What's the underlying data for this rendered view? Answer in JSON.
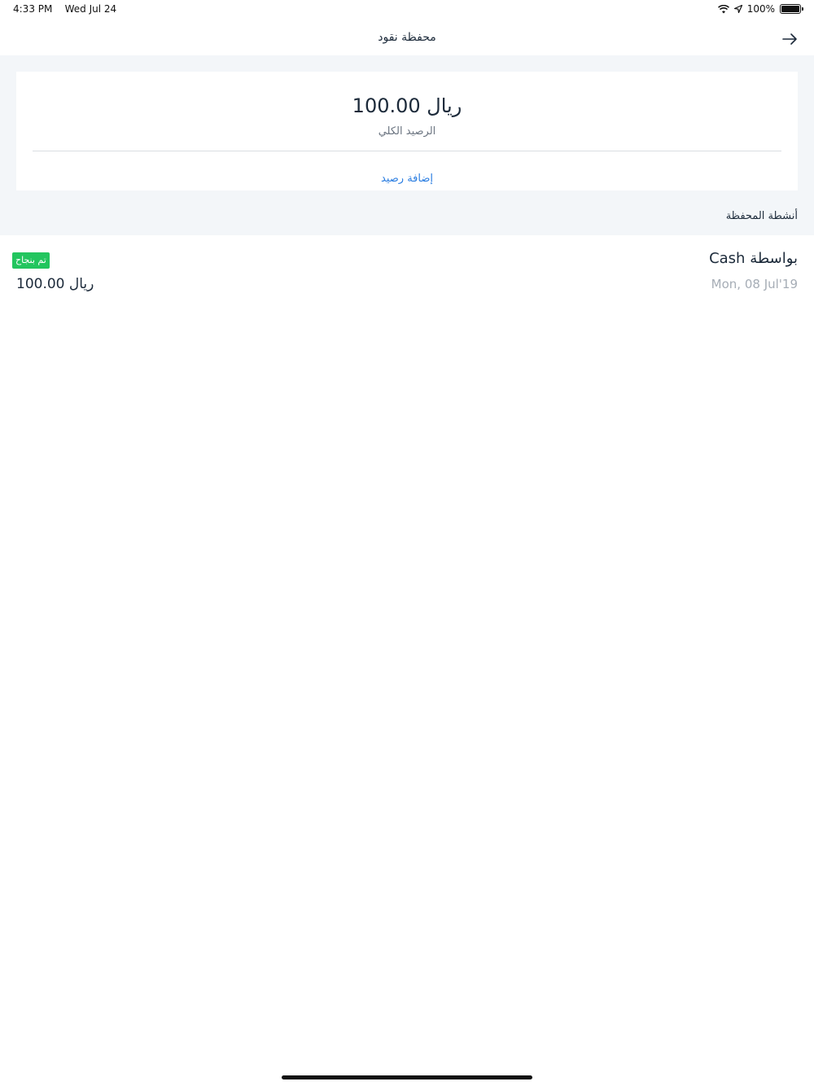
{
  "status_bar": {
    "time": "4:33 PM",
    "date": "Wed Jul 24",
    "battery": "100%",
    "battery_level": 1.0
  },
  "nav": {
    "title": "محفظة نقود",
    "back_icon": "arrow-right-icon"
  },
  "balance": {
    "amount": "ريال 100.00",
    "label": "الرصيد الكلي",
    "add_label": "إضافة رصيد"
  },
  "activities_section": {
    "title": "أنشطة المحفظة"
  },
  "activities": [
    {
      "method": "بواسطة Cash",
      "date": "Mon, 08 Jul'19",
      "status": "تم بنجاح",
      "amount": "ريال 100.00"
    }
  ],
  "colors": {
    "accent": "#2a7de1",
    "success": "#22c55e",
    "background_grey": "#f3f6f9"
  }
}
